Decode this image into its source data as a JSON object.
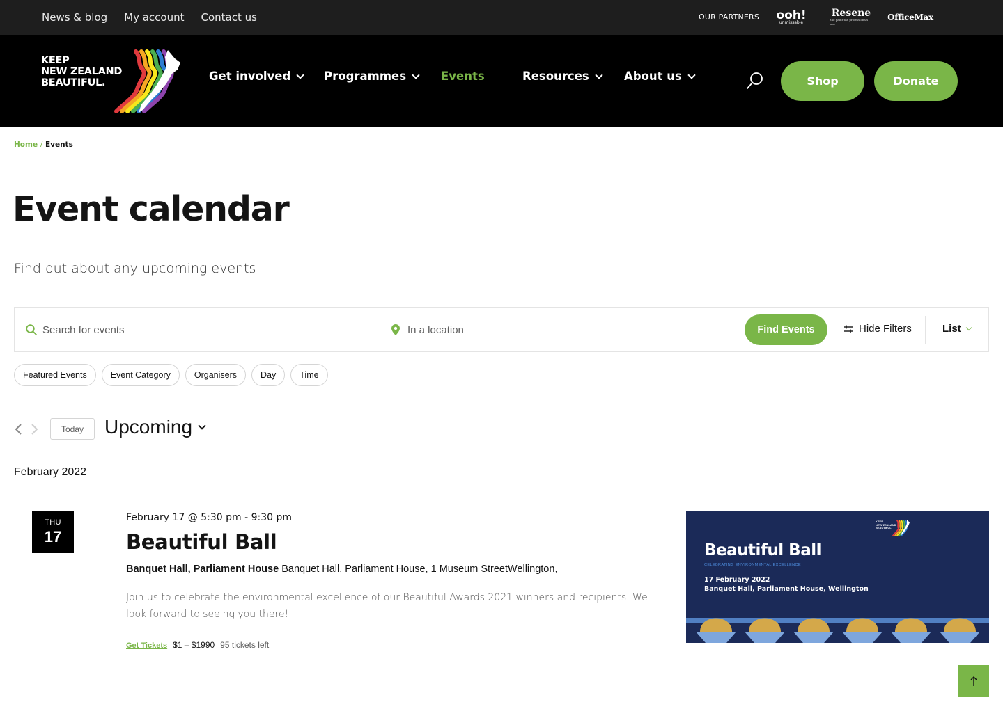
{
  "topbar": {
    "links": [
      "News & blog",
      "My account",
      "Contact us"
    ],
    "partners_label": "OUR PARTNERS",
    "partners": {
      "ooh": "ooh!",
      "ooh_sub": "unmissable",
      "resene": "Resene",
      "resene_sub": "the paint the professionals use",
      "officemax": "OfficeMax"
    }
  },
  "header": {
    "logo_lines": [
      "KEEP",
      "NEW ZEALAND",
      "BEAUTIFUL."
    ],
    "nav": [
      {
        "label": "Get involved",
        "has_dropdown": true,
        "active": false
      },
      {
        "label": "Programmes",
        "has_dropdown": true,
        "active": false
      },
      {
        "label": "Events",
        "has_dropdown": false,
        "active": true
      },
      {
        "label": "Resources",
        "has_dropdown": true,
        "active": false
      },
      {
        "label": "About us",
        "has_dropdown": true,
        "active": false
      }
    ],
    "shop_label": "Shop",
    "donate_label": "Donate"
  },
  "breadcrumb": {
    "home": "Home",
    "separator": "/",
    "current": "Events"
  },
  "page": {
    "title": "Event calendar",
    "subtitle": "Find out about any upcoming events"
  },
  "searchbar": {
    "search_placeholder": "Search for events",
    "location_placeholder": "In a location",
    "find_label": "Find Events",
    "hide_filters_label": "Hide Filters",
    "view_label": "List"
  },
  "filters": [
    "Featured Events",
    "Event Category",
    "Organisers",
    "Day",
    "Time"
  ],
  "calendar_nav": {
    "today_label": "Today",
    "range_label": "Upcoming"
  },
  "month": "February 2022",
  "event": {
    "dow": "THU",
    "day": "17",
    "datetime": "February 17 @ 5:30 pm - 9:30 pm",
    "title": "Beautiful Ball",
    "venue_name": "Banquet Hall, Parliament House",
    "venue_address": "Banquet Hall, Parliament House, 1 Museum StreetWellington,",
    "description": "Join us to celebrate the environmental excellence of our Beautiful Awards 2021 winners and recipients. We look forward to seeing you there!",
    "tickets_label": "Get Tickets",
    "price": "$1 – $1990",
    "tickets_left": "95 tickets left",
    "image": {
      "title": "Beautiful Ball",
      "tagline": "CELEBRATING ENVIRONMENTAL EXCELLENCE",
      "date": "17 February 2022",
      "venue": "Banquet Hall, Parliament House, Wellington",
      "logo_lines": [
        "KEEP",
        "NEW ZEALAND",
        "BEAUTIFUL"
      ]
    }
  },
  "colors": {
    "accent_green": "#7ab648",
    "header_black": "#000000",
    "topbar_dark": "#1e1e1e",
    "image_navy": "#1b2a58"
  }
}
